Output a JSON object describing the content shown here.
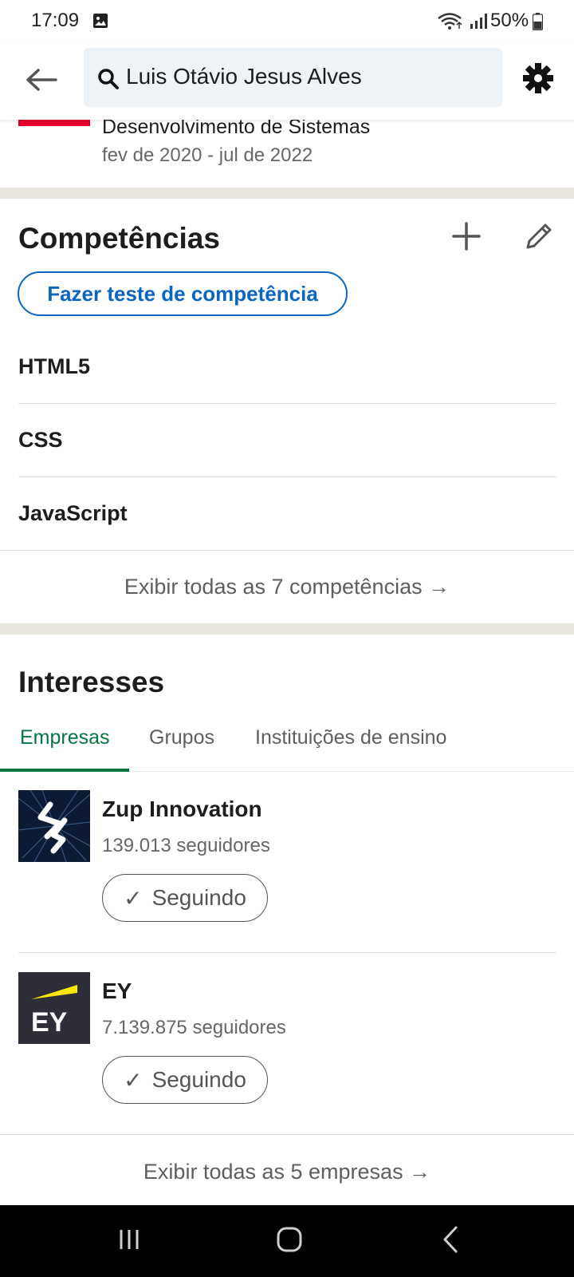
{
  "status_bar": {
    "time": "17:09",
    "battery": "50%",
    "icons": [
      "gallery-icon",
      "wifi-icon",
      "signal-icon",
      "battery-icon"
    ]
  },
  "header": {
    "search_value": "Luis Otávio Jesus Alves",
    "icons": [
      "back-arrow-icon",
      "search-icon",
      "gear-icon"
    ]
  },
  "experience": {
    "title": "Desenvolvimento de Sistemas",
    "date_range": "fev de 2020 - jul de 2022",
    "logo_color": "#e4002b"
  },
  "skills": {
    "title": "Competências",
    "test_button": "Fazer teste de competência",
    "items": [
      "HTML5",
      "CSS",
      "JavaScript"
    ],
    "show_all": "Exibir todas as 7 competências →",
    "icons": [
      "plus-icon",
      "pencil-icon"
    ]
  },
  "interests": {
    "title": "Interesses",
    "tabs": [
      "Empresas",
      "Grupos",
      "Instituições de ensino"
    ],
    "active_tab": "Empresas",
    "companies": [
      {
        "name": "Zup Innovation",
        "followers": "139.013 seguidores",
        "button": "Seguindo"
      },
      {
        "name": "EY",
        "followers": "7.139.875 seguidores",
        "button": "Seguindo"
      }
    ],
    "show_all": "Exibir todas as 5 empresas →"
  },
  "colors": {
    "accent_blue": "#0a66c2",
    "accent_green": "#057642",
    "ey_yellow": "#ffe600",
    "ey_dark": "#2e2e38"
  },
  "nav_bar": {
    "icons": [
      "recent-apps-icon",
      "home-icon",
      "back-icon"
    ]
  }
}
